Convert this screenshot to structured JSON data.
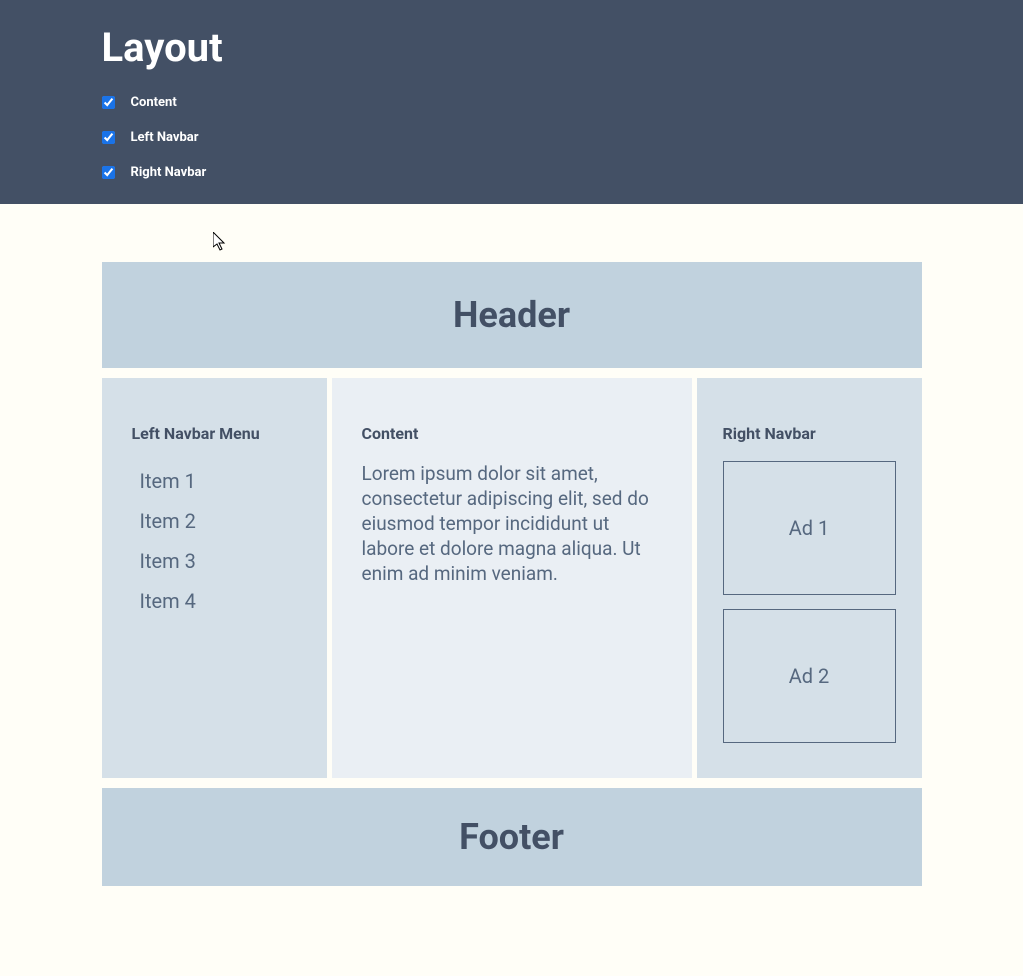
{
  "top": {
    "title": "Layout",
    "toggles": [
      {
        "label": "Content",
        "checked": true
      },
      {
        "label": "Left Navbar",
        "checked": true
      },
      {
        "label": "Right Navbar",
        "checked": true
      }
    ]
  },
  "demo": {
    "header": "Header",
    "left_nav": {
      "heading": "Left Navbar Menu",
      "items": [
        "Item 1",
        "Item 2",
        "Item 3",
        "Item 4"
      ]
    },
    "content": {
      "heading": "Content",
      "body": "Lorem ipsum dolor sit amet, consectetur adipiscing elit, sed do eiusmod tempor incididunt ut labore et dolore magna aliqua. Ut enim ad minim veniam."
    },
    "right_nav": {
      "heading": "Right Navbar",
      "ads": [
        "Ad 1",
        "Ad 2"
      ]
    },
    "footer": "Footer"
  }
}
